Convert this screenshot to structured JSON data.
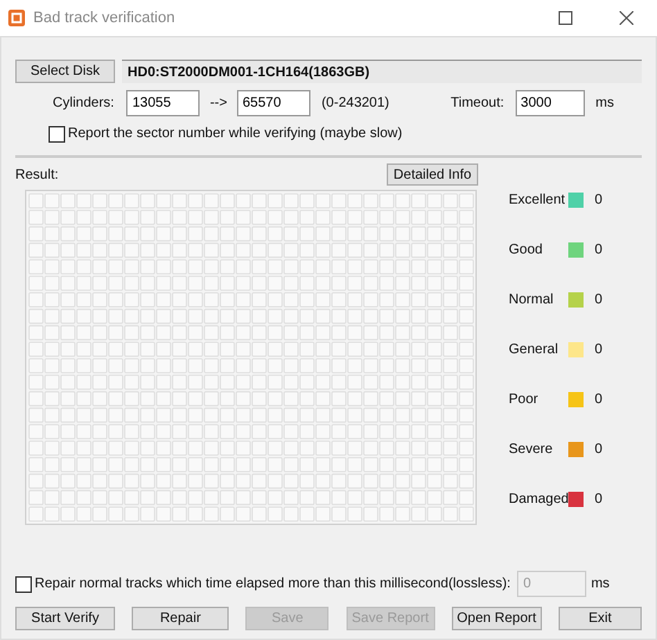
{
  "window": {
    "title": "Bad track verification"
  },
  "disk": {
    "button": "Select Disk",
    "name": "HD0:ST2000DM001-1CH164(1863GB)"
  },
  "cylinders": {
    "label": "Cylinders:",
    "from": "13055",
    "arrow": "-->",
    "to": "65570",
    "range": "(0-243201)"
  },
  "timeout": {
    "label": "Timeout:",
    "value": "3000",
    "unit": "ms"
  },
  "report_sector": {
    "label": "Report the sector number while verifying (maybe slow)",
    "checked": false
  },
  "result": {
    "label": "Result:",
    "details_button": "Detailed Info"
  },
  "legend": [
    {
      "label": "Excellent",
      "color": "#4fd1a8",
      "count": "0"
    },
    {
      "label": "Good",
      "color": "#6fd47e",
      "count": "0"
    },
    {
      "label": "Normal",
      "color": "#b5d24a",
      "count": "0"
    },
    {
      "label": "General",
      "color": "#fde68a",
      "count": "0"
    },
    {
      "label": "Poor",
      "color": "#f6c417",
      "count": "0"
    },
    {
      "label": "Severe",
      "color": "#e8961c",
      "count": "0"
    },
    {
      "label": "Damaged",
      "color": "#d8333f",
      "count": "0"
    }
  ],
  "repair_option": {
    "label": "Repair normal tracks which time elapsed more than this millisecond(lossless):",
    "checked": false,
    "value": "0",
    "disabled": true,
    "unit": "ms"
  },
  "buttons": [
    {
      "label": "Start Verify",
      "disabled": false
    },
    {
      "label": "Repair",
      "disabled": false
    },
    {
      "label": "Save",
      "disabled": true
    },
    {
      "label": "Save Report",
      "disabled": true
    },
    {
      "label": "Open Report",
      "disabled": false
    },
    {
      "label": "Exit",
      "disabled": false
    }
  ]
}
